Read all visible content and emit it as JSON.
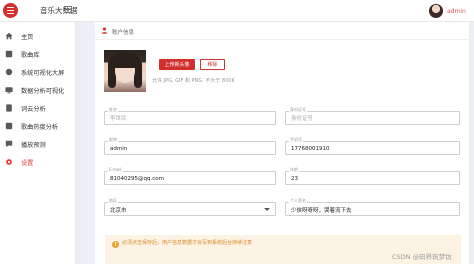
{
  "app": {
    "brand": "音乐大数据",
    "username": "admin"
  },
  "sidebar": {
    "items": [
      {
        "label": "主页",
        "icon": "home-icon"
      },
      {
        "label": "歌曲库",
        "icon": "library-icon"
      },
      {
        "label": "系统可视化大屏",
        "icon": "monitor-icon"
      },
      {
        "label": "数据分析可视化",
        "icon": "chart-icon"
      },
      {
        "label": "词云分析",
        "icon": "cloud-icon"
      },
      {
        "label": "歌曲热度分析",
        "icon": "fire-icon"
      },
      {
        "label": "播放预测",
        "icon": "predict-icon"
      },
      {
        "label": "设置",
        "icon": "gear-icon",
        "active": true
      }
    ]
  },
  "profile": {
    "card_title": "账户信息",
    "upload_label": "上传新头像",
    "remove_label": "移除",
    "hint": "允许 JPG, GIF 和 PNG. 不大于 800K"
  },
  "form": {
    "name": {
      "label": "姓名",
      "value": "",
      "placeholder": "李世民"
    },
    "idcard": {
      "label": "身份证号",
      "value": "",
      "placeholder": "身份证号"
    },
    "account": {
      "label": "昵称",
      "value": "admin"
    },
    "phone": {
      "label": "手机号",
      "value": "17768001910"
    },
    "email": {
      "label": "E-mail",
      "value": "81040295@qq.com"
    },
    "age": {
      "label": "年龄",
      "value": "23"
    },
    "city": {
      "label": "地区",
      "value": "北京市"
    },
    "signature": {
      "label": "个人签名",
      "value": "少侠呀呀呀，哭着流下去"
    }
  },
  "alert": {
    "text": "必须点击保存后，用户信息数据才会写到系统后台持续注意"
  },
  "watermark": "CSDN @码界筑梦坊",
  "colors": {
    "accent": "#d32f2f",
    "alert_bg": "#fdf3e4",
    "alert_text": "#d48a2a"
  }
}
